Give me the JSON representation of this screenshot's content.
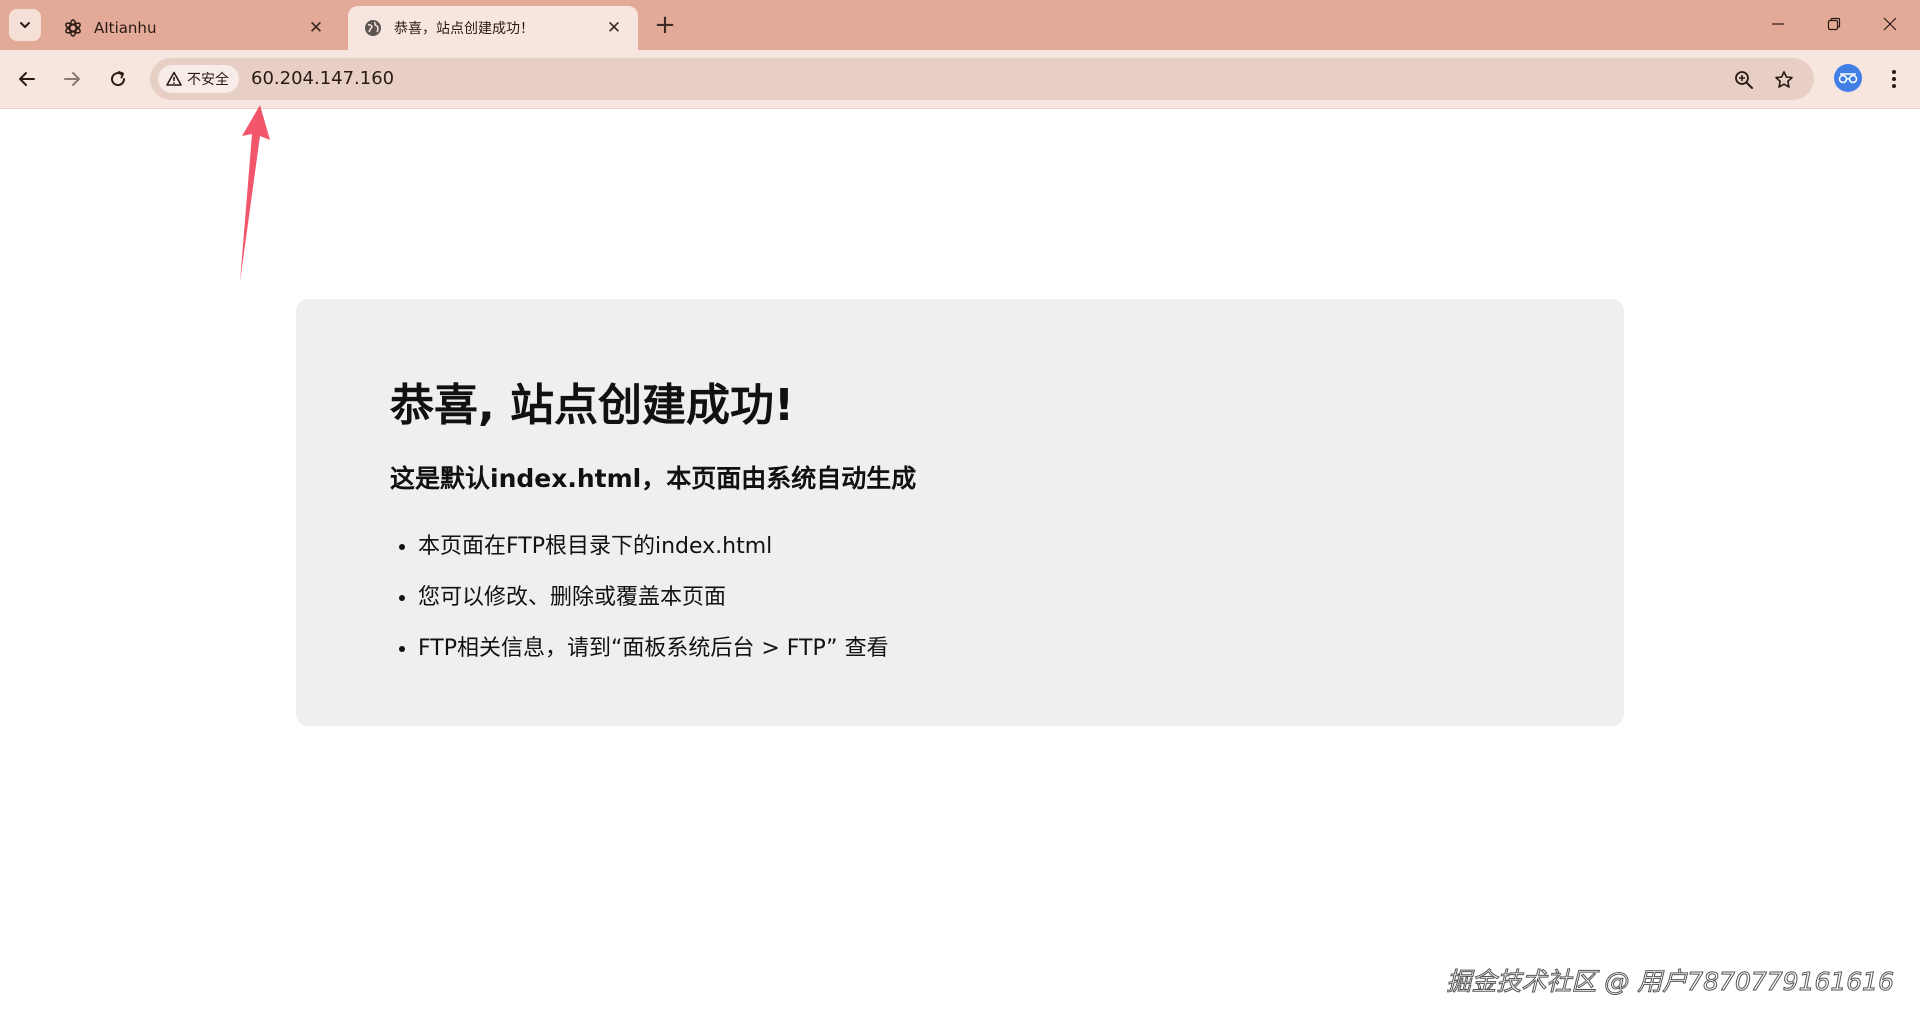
{
  "browser": {
    "tabs": [
      {
        "title": "AItianhu",
        "favicon": "openai-icon",
        "active": false
      },
      {
        "title": "恭喜，站点创建成功！",
        "favicon": "globe-icon",
        "active": true
      }
    ],
    "address_bar": {
      "security_label": "不安全",
      "url": "60.204.147.160"
    },
    "colors": {
      "tabstrip": "#e3aa97",
      "toolbar": "#f7e6df",
      "omnibox": "#e7cfc6",
      "annotation_arrow": "#f2566b"
    }
  },
  "page": {
    "heading": "恭喜, 站点创建成功!",
    "subheading": "这是默认index.html，本页面由系统自动生成",
    "list_items": [
      "本页面在FTP根目录下的index.html",
      "您可以修改、删除或覆盖本页面",
      "FTP相关信息，请到“面板系统后台 > FTP” 查看"
    ]
  },
  "watermark": "掘金技术社区 @ 用户7870779161616"
}
